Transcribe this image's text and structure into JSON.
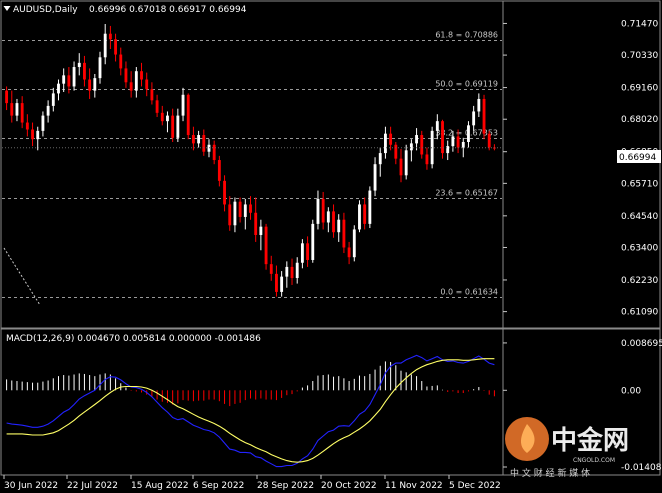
{
  "header": {
    "symbol": "AUDUSD,Daily",
    "ohlc": "0.66996 0.67018 0.66917 0.66994"
  },
  "macd_header": "MACD(12,26,9) 0.004670 0.005814 0.000000 -0.001486",
  "price_tag": "0.66994",
  "colors": {
    "background": "#000000",
    "bull": "#ffffff",
    "bear": "#ff0000",
    "macd_main": "#2222ff",
    "macd_signal": "#ffff66",
    "grid": "#9a9a9a"
  },
  "icons": {
    "minimize": "triangle-down-icon"
  },
  "watermark": {
    "text": "中金网",
    "subtext": "CNGOLD.COM",
    "tagline": "中 文 财 经 新 媒 体"
  },
  "chart_data": [
    {
      "type": "candlestick",
      "title": "AUDUSD,Daily",
      "y_ticks": [
        0.7147,
        0.7033,
        0.6916,
        0.6802,
        0.6685,
        0.6571,
        0.6454,
        0.634,
        0.6223,
        0.6109
      ],
      "y_tick_labels": [
        "0.71470",
        "0.70330",
        "0.69160",
        "0.68020",
        "0.66850",
        "0.65710",
        "0.64540",
        "0.63400",
        "0.62230",
        "0.61090"
      ],
      "ylim": [
        0.6086,
        0.7181
      ],
      "x_labels": [
        "30 Jun 2022",
        "22 Jul 2022",
        "15 Aug 2022",
        "6 Sep 2022",
        "28 Sep 2022",
        "20 Oct 2022",
        "11 Nov 2022",
        "5 Dec 2022"
      ],
      "fib_levels": [
        {
          "label": "61.8 = 0.70886",
          "value": 0.70886
        },
        {
          "label": "50.0 = 0.69119",
          "value": 0.69119
        },
        {
          "label": "38.2 = 0.67353",
          "value": 0.67353
        },
        {
          "label": "23.6 = 0.65167",
          "value": 0.65167
        },
        {
          "label": "0.0 = 0.61634",
          "value": 0.61634
        }
      ],
      "last_price": 0.66994,
      "candles": [
        {
          "o": 0.6905,
          "h": 0.692,
          "l": 0.6835,
          "c": 0.686
        },
        {
          "o": 0.686,
          "h": 0.6905,
          "l": 0.679,
          "c": 0.6815
        },
        {
          "o": 0.6815,
          "h": 0.6875,
          "l": 0.6795,
          "c": 0.686
        },
        {
          "o": 0.686,
          "h": 0.6885,
          "l": 0.677,
          "c": 0.679
        },
        {
          "o": 0.679,
          "h": 0.682,
          "l": 0.674,
          "c": 0.6765
        },
        {
          "o": 0.6765,
          "h": 0.679,
          "l": 0.6705,
          "c": 0.673
        },
        {
          "o": 0.673,
          "h": 0.6775,
          "l": 0.669,
          "c": 0.676
        },
        {
          "o": 0.676,
          "h": 0.683,
          "l": 0.674,
          "c": 0.6815
        },
        {
          "o": 0.6815,
          "h": 0.687,
          "l": 0.679,
          "c": 0.685
        },
        {
          "o": 0.685,
          "h": 0.6915,
          "l": 0.683,
          "c": 0.6895
        },
        {
          "o": 0.6895,
          "h": 0.6945,
          "l": 0.687,
          "c": 0.693
        },
        {
          "o": 0.693,
          "h": 0.6985,
          "l": 0.69,
          "c": 0.696
        },
        {
          "o": 0.696,
          "h": 0.699,
          "l": 0.6895,
          "c": 0.692
        },
        {
          "o": 0.692,
          "h": 0.701,
          "l": 0.6905,
          "c": 0.699
        },
        {
          "o": 0.699,
          "h": 0.704,
          "l": 0.696,
          "c": 0.7005
        },
        {
          "o": 0.7005,
          "h": 0.703,
          "l": 0.692,
          "c": 0.6945
        },
        {
          "o": 0.6945,
          "h": 0.6985,
          "l": 0.6875,
          "c": 0.6905
        },
        {
          "o": 0.6905,
          "h": 0.6965,
          "l": 0.688,
          "c": 0.695
        },
        {
          "o": 0.695,
          "h": 0.7045,
          "l": 0.693,
          "c": 0.7025
        },
        {
          "o": 0.7025,
          "h": 0.7145,
          "l": 0.7,
          "c": 0.711
        },
        {
          "o": 0.711,
          "h": 0.7138,
          "l": 0.7055,
          "c": 0.709
        },
        {
          "o": 0.709,
          "h": 0.711,
          "l": 0.701,
          "c": 0.7035
        },
        {
          "o": 0.7035,
          "h": 0.706,
          "l": 0.696,
          "c": 0.6985
        },
        {
          "o": 0.6985,
          "h": 0.701,
          "l": 0.6915,
          "c": 0.6935
        },
        {
          "o": 0.6935,
          "h": 0.6975,
          "l": 0.688,
          "c": 0.6905
        },
        {
          "o": 0.6905,
          "h": 0.699,
          "l": 0.688,
          "c": 0.6975
        },
        {
          "o": 0.6975,
          "h": 0.7005,
          "l": 0.692,
          "c": 0.6945
        },
        {
          "o": 0.6945,
          "h": 0.697,
          "l": 0.6885,
          "c": 0.691
        },
        {
          "o": 0.691,
          "h": 0.6935,
          "l": 0.6855,
          "c": 0.687
        },
        {
          "o": 0.687,
          "h": 0.689,
          "l": 0.681,
          "c": 0.6825
        },
        {
          "o": 0.6825,
          "h": 0.685,
          "l": 0.678,
          "c": 0.6795
        },
        {
          "o": 0.6795,
          "h": 0.683,
          "l": 0.6755,
          "c": 0.6815
        },
        {
          "o": 0.6815,
          "h": 0.684,
          "l": 0.672,
          "c": 0.6735
        },
        {
          "o": 0.6735,
          "h": 0.684,
          "l": 0.672,
          "c": 0.6815
        },
        {
          "o": 0.6815,
          "h": 0.6915,
          "l": 0.6795,
          "c": 0.689
        },
        {
          "o": 0.689,
          "h": 0.6895,
          "l": 0.673,
          "c": 0.6745
        },
        {
          "o": 0.6745,
          "h": 0.6775,
          "l": 0.669,
          "c": 0.6715
        },
        {
          "o": 0.6715,
          "h": 0.676,
          "l": 0.67,
          "c": 0.6745
        },
        {
          "o": 0.6745,
          "h": 0.6765,
          "l": 0.667,
          "c": 0.6685
        },
        {
          "o": 0.6685,
          "h": 0.673,
          "l": 0.6665,
          "c": 0.671
        },
        {
          "o": 0.671,
          "h": 0.6725,
          "l": 0.664,
          "c": 0.6655
        },
        {
          "o": 0.6655,
          "h": 0.667,
          "l": 0.656,
          "c": 0.658
        },
        {
          "o": 0.658,
          "h": 0.66,
          "l": 0.647,
          "c": 0.6495
        },
        {
          "o": 0.6495,
          "h": 0.6525,
          "l": 0.64,
          "c": 0.642
        },
        {
          "o": 0.642,
          "h": 0.652,
          "l": 0.6395,
          "c": 0.6505
        },
        {
          "o": 0.6505,
          "h": 0.652,
          "l": 0.643,
          "c": 0.645
        },
        {
          "o": 0.645,
          "h": 0.6515,
          "l": 0.6405,
          "c": 0.6495
        },
        {
          "o": 0.6495,
          "h": 0.6525,
          "l": 0.644,
          "c": 0.6465
        },
        {
          "o": 0.6465,
          "h": 0.652,
          "l": 0.636,
          "c": 0.6385
        },
        {
          "o": 0.6385,
          "h": 0.644,
          "l": 0.633,
          "c": 0.6415
        },
        {
          "o": 0.6415,
          "h": 0.6425,
          "l": 0.626,
          "c": 0.628
        },
        {
          "o": 0.628,
          "h": 0.631,
          "l": 0.622,
          "c": 0.6245
        },
        {
          "o": 0.6245,
          "h": 0.6275,
          "l": 0.6163,
          "c": 0.618
        },
        {
          "o": 0.618,
          "h": 0.6255,
          "l": 0.6163,
          "c": 0.6235
        },
        {
          "o": 0.6235,
          "h": 0.629,
          "l": 0.6195,
          "c": 0.627
        },
        {
          "o": 0.627,
          "h": 0.63,
          "l": 0.6205,
          "c": 0.623
        },
        {
          "o": 0.623,
          "h": 0.6305,
          "l": 0.621,
          "c": 0.6285
        },
        {
          "o": 0.6285,
          "h": 0.637,
          "l": 0.6265,
          "c": 0.6355
        },
        {
          "o": 0.6355,
          "h": 0.638,
          "l": 0.627,
          "c": 0.6295
        },
        {
          "o": 0.6295,
          "h": 0.644,
          "l": 0.6285,
          "c": 0.6425
        },
        {
          "o": 0.6425,
          "h": 0.6545,
          "l": 0.6405,
          "c": 0.6515
        },
        {
          "o": 0.6515,
          "h": 0.654,
          "l": 0.6405,
          "c": 0.643
        },
        {
          "o": 0.643,
          "h": 0.6485,
          "l": 0.6395,
          "c": 0.647
        },
        {
          "o": 0.647,
          "h": 0.6495,
          "l": 0.6375,
          "c": 0.6395
        },
        {
          "o": 0.6395,
          "h": 0.646,
          "l": 0.636,
          "c": 0.644
        },
        {
          "o": 0.644,
          "h": 0.6465,
          "l": 0.632,
          "c": 0.634
        },
        {
          "o": 0.634,
          "h": 0.636,
          "l": 0.628,
          "c": 0.6305
        },
        {
          "o": 0.6305,
          "h": 0.642,
          "l": 0.629,
          "c": 0.6405
        },
        {
          "o": 0.6405,
          "h": 0.651,
          "l": 0.6395,
          "c": 0.6495
        },
        {
          "o": 0.6495,
          "h": 0.652,
          "l": 0.6405,
          "c": 0.6425
        },
        {
          "o": 0.6425,
          "h": 0.656,
          "l": 0.641,
          "c": 0.6545
        },
        {
          "o": 0.6545,
          "h": 0.6665,
          "l": 0.6525,
          "c": 0.664
        },
        {
          "o": 0.664,
          "h": 0.67,
          "l": 0.6595,
          "c": 0.668
        },
        {
          "o": 0.668,
          "h": 0.6775,
          "l": 0.666,
          "c": 0.675
        },
        {
          "o": 0.675,
          "h": 0.6775,
          "l": 0.669,
          "c": 0.671
        },
        {
          "o": 0.671,
          "h": 0.672,
          "l": 0.664,
          "c": 0.666
        },
        {
          "o": 0.666,
          "h": 0.6695,
          "l": 0.6575,
          "c": 0.66
        },
        {
          "o": 0.66,
          "h": 0.671,
          "l": 0.6585,
          "c": 0.669
        },
        {
          "o": 0.669,
          "h": 0.673,
          "l": 0.665,
          "c": 0.6715
        },
        {
          "o": 0.6715,
          "h": 0.677,
          "l": 0.669,
          "c": 0.6745
        },
        {
          "o": 0.6745,
          "h": 0.676,
          "l": 0.666,
          "c": 0.6675
        },
        {
          "o": 0.6675,
          "h": 0.67,
          "l": 0.662,
          "c": 0.664
        },
        {
          "o": 0.664,
          "h": 0.6775,
          "l": 0.6625,
          "c": 0.676
        },
        {
          "o": 0.676,
          "h": 0.682,
          "l": 0.673,
          "c": 0.6795
        },
        {
          "o": 0.6795,
          "h": 0.68,
          "l": 0.666,
          "c": 0.668
        },
        {
          "o": 0.668,
          "h": 0.6725,
          "l": 0.6655,
          "c": 0.6705
        },
        {
          "o": 0.6705,
          "h": 0.676,
          "l": 0.6685,
          "c": 0.674
        },
        {
          "o": 0.674,
          "h": 0.6765,
          "l": 0.668,
          "c": 0.67
        },
        {
          "o": 0.67,
          "h": 0.6735,
          "l": 0.6665,
          "c": 0.672
        },
        {
          "o": 0.672,
          "h": 0.6795,
          "l": 0.67,
          "c": 0.678
        },
        {
          "o": 0.678,
          "h": 0.685,
          "l": 0.676,
          "c": 0.683
        },
        {
          "o": 0.683,
          "h": 0.6895,
          "l": 0.681,
          "c": 0.6875
        },
        {
          "o": 0.6875,
          "h": 0.689,
          "l": 0.673,
          "c": 0.675
        },
        {
          "o": 0.675,
          "h": 0.676,
          "l": 0.669,
          "c": 0.67
        },
        {
          "o": 0.67,
          "h": 0.6712,
          "l": 0.669,
          "c": 0.6699
        }
      ]
    },
    {
      "type": "line",
      "title": "MACD(12,26,9) 0.004670 0.005814 0.000000 -0.001486",
      "y_tick_labels": [
        "0.008695",
        "0.00",
        "-0.014082"
      ],
      "y_ticks": [
        0.008695,
        0.0,
        -0.014082
      ],
      "ylim": [
        -0.015,
        0.0096
      ],
      "series": [
        {
          "name": "MACD",
          "values": [
            -0.006,
            -0.0062,
            -0.0063,
            -0.0064,
            -0.0066,
            -0.0068,
            -0.0068,
            -0.0066,
            -0.0062,
            -0.0056,
            -0.0048,
            -0.004,
            -0.0035,
            -0.0026,
            -0.0016,
            -0.001,
            -0.0005,
            0.0,
            0.001,
            0.002,
            0.0025,
            0.0024,
            0.0019,
            0.0012,
            0.0006,
            0.0005,
            0.0002,
            -0.0004,
            -0.0012,
            -0.0022,
            -0.0032,
            -0.004,
            -0.005,
            -0.0054,
            -0.0052,
            -0.0058,
            -0.0064,
            -0.0068,
            -0.0072,
            -0.0074,
            -0.0078,
            -0.0086,
            -0.0097,
            -0.0108,
            -0.011,
            -0.0114,
            -0.0114,
            -0.0115,
            -0.0122,
            -0.0124,
            -0.013,
            -0.0135,
            -0.014,
            -0.014,
            -0.0138,
            -0.0138,
            -0.0134,
            -0.0126,
            -0.012,
            -0.0108,
            -0.0092,
            -0.0084,
            -0.0076,
            -0.0073,
            -0.0066,
            -0.0065,
            -0.0066,
            -0.0056,
            -0.0044,
            -0.0038,
            -0.0026,
            -0.0008,
            0.001,
            0.0032,
            0.0044,
            0.005,
            0.005,
            0.0056,
            0.006,
            0.0064,
            0.006,
            0.0054,
            0.0058,
            0.0062,
            0.0056,
            0.0053,
            0.0054,
            0.0051,
            0.005,
            0.0053,
            0.0058,
            0.0063,
            0.0057,
            0.005,
            0.0047
          ]
        },
        {
          "name": "Signal",
          "values": [
            -0.008,
            -0.008,
            -0.008,
            -0.008,
            -0.0081,
            -0.0082,
            -0.0082,
            -0.0082,
            -0.008,
            -0.0078,
            -0.0074,
            -0.0068,
            -0.0062,
            -0.0055,
            -0.0047,
            -0.004,
            -0.0033,
            -0.0026,
            -0.0019,
            -0.0011,
            -0.0004,
            0.0002,
            0.0006,
            0.0007,
            0.0007,
            0.0007,
            0.0006,
            0.0004,
            0.0,
            -0.0005,
            -0.0011,
            -0.0017,
            -0.0024,
            -0.003,
            -0.0034,
            -0.0039,
            -0.0044,
            -0.0049,
            -0.0053,
            -0.0057,
            -0.0061,
            -0.0066,
            -0.0072,
            -0.0079,
            -0.0085,
            -0.0091,
            -0.0096,
            -0.01,
            -0.0105,
            -0.0109,
            -0.0113,
            -0.0118,
            -0.0122,
            -0.0126,
            -0.0129,
            -0.0131,
            -0.0132,
            -0.0131,
            -0.0129,
            -0.0125,
            -0.0119,
            -0.0112,
            -0.0105,
            -0.0098,
            -0.0092,
            -0.0087,
            -0.0083,
            -0.0077,
            -0.0071,
            -0.0064,
            -0.0056,
            -0.0046,
            -0.0035,
            -0.0021,
            -0.0008,
            0.0004,
            0.0014,
            0.0023,
            0.0031,
            0.0038,
            0.0043,
            0.0047,
            0.005,
            0.0053,
            0.0055,
            0.0056,
            0.0056,
            0.0056,
            0.0055,
            0.0055,
            0.0056,
            0.0057,
            0.0058,
            0.0058,
            0.0058
          ]
        },
        {
          "name": "Histogram",
          "values": [
            0.002,
            0.0018,
            0.0017,
            0.0016,
            0.0015,
            0.0014,
            0.0014,
            0.0016,
            0.0018,
            0.0022,
            0.0026,
            0.0028,
            0.0027,
            0.0029,
            0.0031,
            0.003,
            0.0028,
            0.0026,
            0.0029,
            0.0031,
            0.0029,
            0.0022,
            0.0013,
            0.0005,
            -0.0001,
            -0.0002,
            -0.0004,
            -0.0008,
            -0.0012,
            -0.0017,
            -0.0021,
            -0.0023,
            -0.0026,
            -0.0024,
            -0.0018,
            -0.0019,
            -0.002,
            -0.0019,
            -0.0019,
            -0.0017,
            -0.0017,
            -0.002,
            -0.0025,
            -0.0029,
            -0.0025,
            -0.0023,
            -0.0018,
            -0.0015,
            -0.0017,
            -0.0015,
            -0.0017,
            -0.0017,
            -0.0018,
            -0.0014,
            -0.0009,
            -0.0007,
            -0.0002,
            0.0005,
            0.0009,
            0.0017,
            0.0027,
            0.0028,
            0.0029,
            0.0025,
            0.0026,
            0.0022,
            0.0017,
            0.0021,
            0.0027,
            0.0026,
            0.003,
            0.0038,
            0.0045,
            0.0053,
            0.0052,
            0.0046,
            0.0036,
            0.0033,
            0.0029,
            0.0026,
            0.0017,
            0.0007,
            0.0008,
            0.0009,
            0.0001,
            -0.0003,
            -0.0002,
            -0.0005,
            -0.0005,
            -0.0002,
            0.0002,
            0.0006,
            -0.0001,
            -0.0008,
            -0.0011
          ]
        }
      ]
    }
  ]
}
